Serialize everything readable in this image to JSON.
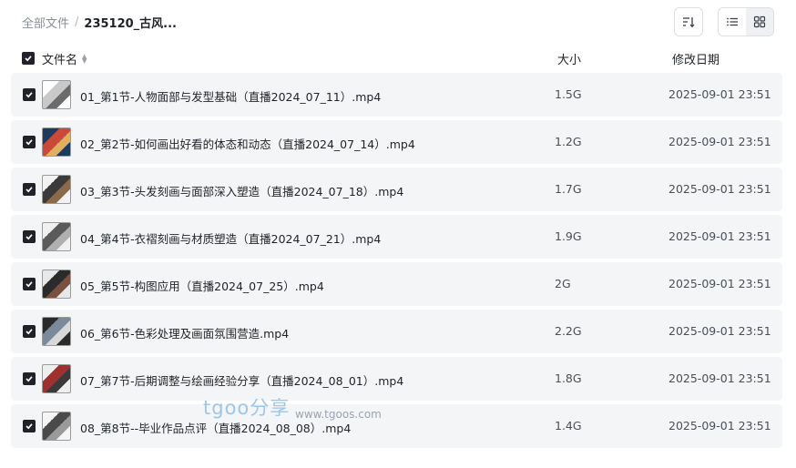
{
  "breadcrumb": {
    "root": "全部文件",
    "separator": "/",
    "current": "235120_古风..."
  },
  "toolbar": {
    "sort_icon": "sort-descending-icon",
    "view_list_icon": "list-view-icon",
    "view_grid_icon": "grid-view-icon",
    "active_view": "grid"
  },
  "table": {
    "headers": {
      "name": "文件名",
      "size": "大小",
      "date": "修改日期"
    },
    "all_selected": true,
    "rows": [
      {
        "name": "01_第1节-人物面部与发型基础（直播2024_07_11）.mp4",
        "size": "1.5G",
        "date": "2025-09-01 23:51",
        "selected": true,
        "thumb_colors": [
          "#ffffff",
          "#c9c9c9",
          "#6b6b6b"
        ]
      },
      {
        "name": "02_第2节-如何画出好看的体态和动态（直播2024_07_14）.mp4",
        "size": "1.2G",
        "date": "2025-09-01 23:51",
        "selected": true,
        "thumb_colors": [
          "#1d3b5c",
          "#c94a3a",
          "#e0b060"
        ]
      },
      {
        "name": "03_第3节-头发刻画与面部深入塑造（直播2024_07_18）.mp4",
        "size": "1.7G",
        "date": "2025-09-01 23:51",
        "selected": true,
        "thumb_colors": [
          "#f2f2f2",
          "#3a3a3a",
          "#8a6a4a"
        ]
      },
      {
        "name": "04_第4节-衣褶刻画与材质塑造（直播2024_07_21）.mp4",
        "size": "1.9G",
        "date": "2025-09-01 23:51",
        "selected": true,
        "thumb_colors": [
          "#f0f0f0",
          "#5a5a5a",
          "#b0b0b0"
        ]
      },
      {
        "name": "05_第5节-构图应用（直播2024_07_25）.mp4",
        "size": "2G",
        "date": "2025-09-01 23:51",
        "selected": true,
        "thumb_colors": [
          "#e8e8e8",
          "#2b2b2b",
          "#7a5040"
        ]
      },
      {
        "name": "06_第6节-色彩处理及画面氛围营造.mp4",
        "size": "2.2G",
        "date": "2025-09-01 23:51",
        "selected": true,
        "thumb_colors": [
          "#2a2a2a",
          "#7a8a9a",
          "#d8d8d8"
        ]
      },
      {
        "name": "07_第7节-后期调整与绘画经验分享（直播2024_08_01）.mp4",
        "size": "1.8G",
        "date": "2025-09-01 23:51",
        "selected": true,
        "thumb_colors": [
          "#eeeeee",
          "#a03030",
          "#3a3a3a"
        ]
      },
      {
        "name": "08_第8节--毕业作品点评（直播2024_08_08）.mp4",
        "size": "1.4G",
        "date": "2025-09-01 23:51",
        "selected": true,
        "thumb_colors": [
          "#f5f5f5",
          "#4a4a4a",
          "#9a9a9a"
        ]
      }
    ]
  },
  "watermark": {
    "brand": "tgoo分享",
    "url": "www.tgoos.com"
  }
}
